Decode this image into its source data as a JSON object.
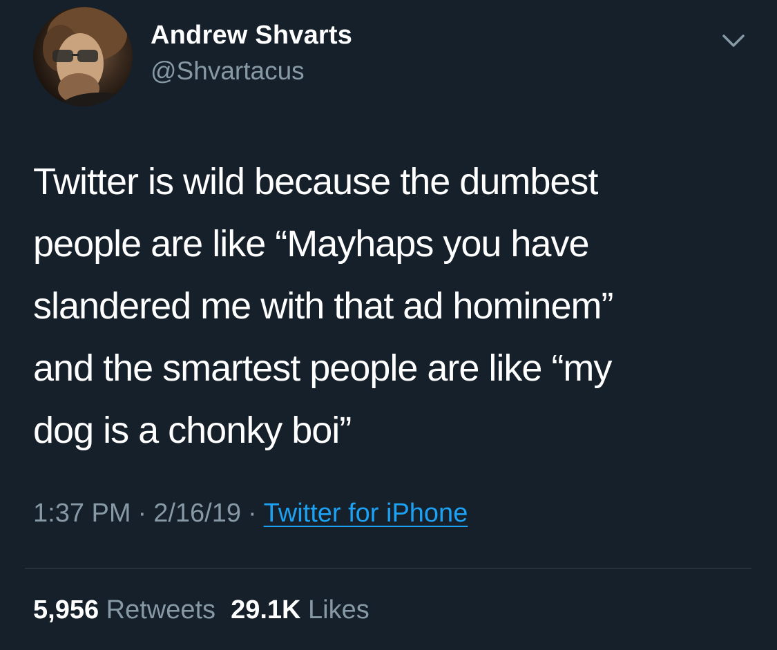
{
  "author": {
    "name": "Andrew Shvarts",
    "handle": "@Shvartacus"
  },
  "tweet": {
    "lines": [
      "Twitter is wild because the dumbest",
      "people are like “Mayhaps you have",
      "slandered me with that ad hominem”",
      "and the smartest people are like “my",
      "dog is a chonky boi”"
    ],
    "time": "1:37 PM",
    "date": "2/16/19",
    "separator": "·",
    "source": "Twitter for iPhone"
  },
  "stats": {
    "retweets_count": "5,956",
    "retweets_label": "Retweets",
    "likes_count": "29.1K",
    "likes_label": "Likes"
  },
  "icons": {
    "menu": "chevron-down-icon"
  },
  "colors": {
    "background": "#15202b",
    "primary_text": "#ffffff",
    "secondary_text": "#8899a6",
    "link": "#1da1f2",
    "divider": "#38444d"
  }
}
